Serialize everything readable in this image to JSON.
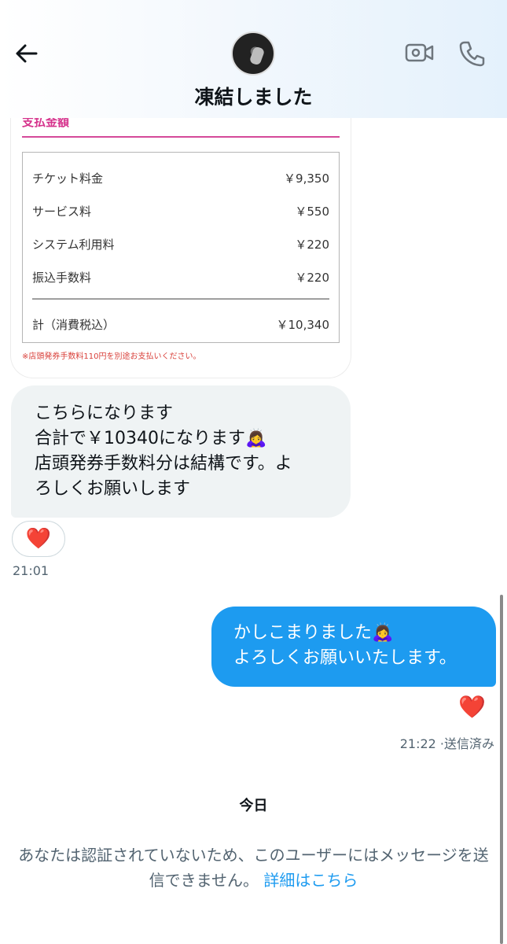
{
  "header": {
    "title": "凍結しました",
    "back_icon": "arrow-left-icon",
    "video_icon": "video-camera-icon",
    "call_icon": "phone-icon"
  },
  "receipt": {
    "heading": "支払金額",
    "rows": [
      {
        "label": "チケット料金",
        "amount": "￥9,350"
      },
      {
        "label": "サービス料",
        "amount": "￥550"
      },
      {
        "label": "システム利用料",
        "amount": "￥220"
      },
      {
        "label": "振込手数料",
        "amount": "￥220"
      }
    ],
    "total_label": "計（消費税込）",
    "total_amount": "￥10,340",
    "note": "※店頭発券手数料110円を別途お支払いください。"
  },
  "incoming": {
    "lines": [
      "こちらになります",
      "合計で￥10340になります",
      "店頭発券手数料分は結構です。よ",
      "ろしくお願いします"
    ],
    "emoji": "🙇‍♀️",
    "reaction": "❤️",
    "time": "21:01"
  },
  "outgoing": {
    "lines": [
      "かしこまりました",
      "よろしくお願いいたします。"
    ],
    "emoji": "🙇‍♀️",
    "reaction": "❤️",
    "time": "21:22 ·送信済み"
  },
  "day_separator": "今日",
  "notice": {
    "text": "あなたは認証されていないため、このユーザーにはメッセージを送信できません。",
    "link": "詳細はこちら"
  },
  "colors": {
    "accent": "#1d9bf0",
    "incoming_bubble": "#eff3f4",
    "receipt_pink": "#d54a9a",
    "heart": "#e0245e"
  }
}
